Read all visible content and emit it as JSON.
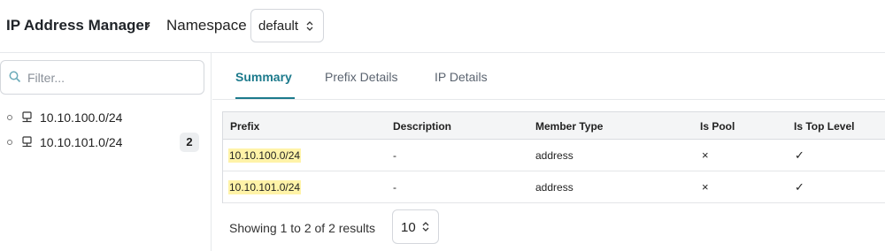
{
  "header": {
    "app_title": "IP Address Manager",
    "crumb_separator": "›",
    "namespace_label": "Namespace",
    "namespace_value": "default"
  },
  "sidebar": {
    "filter_placeholder": "Filter...",
    "items": [
      {
        "label": "10.10.100.0/24",
        "count": ""
      },
      {
        "label": "10.10.101.0/24",
        "count": "2"
      }
    ]
  },
  "tabs": [
    {
      "label": "Summary",
      "active": true
    },
    {
      "label": "Prefix Details",
      "active": false
    },
    {
      "label": "IP Details",
      "active": false
    }
  ],
  "table": {
    "columns": [
      "Prefix",
      "Description",
      "Member Type",
      "Is Pool",
      "Is Top Level"
    ],
    "rows": [
      {
        "prefix": "10.10.100.0/24",
        "description": "-",
        "member_type": "address",
        "is_pool": "×",
        "is_top_level": "✓"
      },
      {
        "prefix": "10.10.101.0/24",
        "description": "-",
        "member_type": "address",
        "is_pool": "×",
        "is_top_level": "✓"
      }
    ]
  },
  "footer": {
    "results_text": "Showing 1 to 2 of 2 results",
    "page_size": "10"
  },
  "colors": {
    "accent": "#1c7a8c",
    "highlight": "#fff3a8"
  }
}
